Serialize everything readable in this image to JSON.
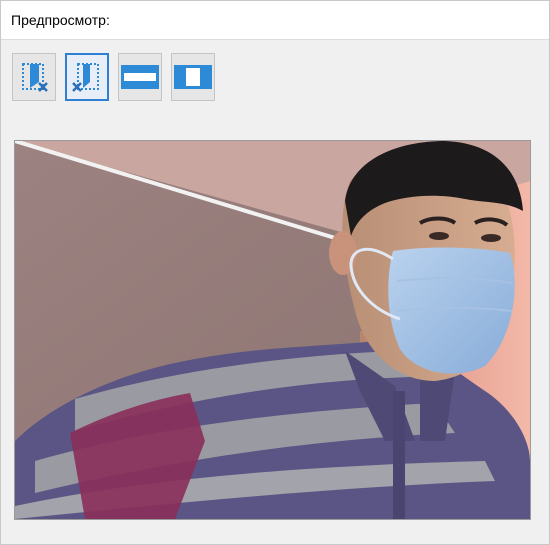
{
  "header": {
    "title": "Предпросмотр:"
  },
  "toolbar": {
    "buttons": [
      {
        "name": "clear-crop-button",
        "icon": "crop-clear-icon",
        "selected": false
      },
      {
        "name": "crop-select-button",
        "icon": "crop-select-icon",
        "selected": true
      },
      {
        "name": "horizontal-strip-button",
        "icon": "horizontal-strip-icon",
        "selected": false
      },
      {
        "name": "vertical-strip-button",
        "icon": "vertical-strip-icon",
        "selected": false
      }
    ]
  },
  "preview": {
    "content": "webcam-photo-person-in-mask"
  },
  "colors": {
    "accent": "#2f7fd2",
    "icon_blue": "#2c8ad6",
    "x_blue": "#2a6fb8"
  }
}
